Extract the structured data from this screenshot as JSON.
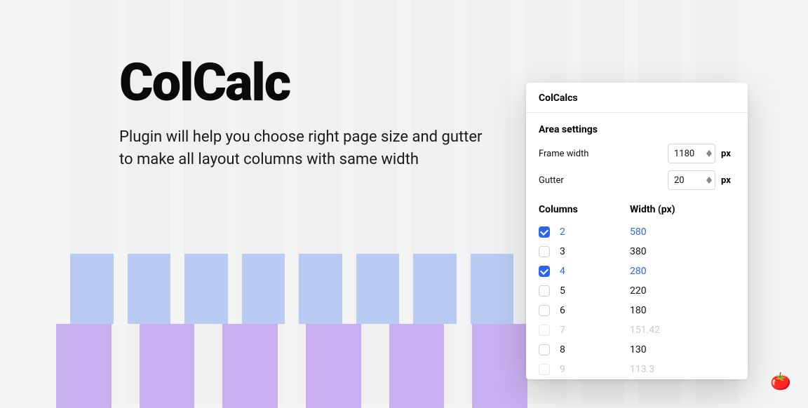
{
  "hero": {
    "title": "ColCalc",
    "subtitle": "Plugin will help you choose right page size and gutter to make all layout columns with same width"
  },
  "panel": {
    "title": "ColCalcs",
    "area_settings": {
      "heading": "Area settings",
      "frame_width_label": "Frame width",
      "frame_width_value": "1180",
      "gutter_label": "Gutter",
      "gutter_value": "20",
      "unit": "px"
    },
    "table": {
      "columns_header": "Columns",
      "width_header": "Width (px)",
      "rows": [
        {
          "cols": "2",
          "width": "580",
          "checked": true,
          "disabled": false
        },
        {
          "cols": "3",
          "width": "380",
          "checked": false,
          "disabled": false
        },
        {
          "cols": "4",
          "width": "280",
          "checked": true,
          "disabled": false
        },
        {
          "cols": "5",
          "width": "220",
          "checked": false,
          "disabled": false
        },
        {
          "cols": "6",
          "width": "180",
          "checked": false,
          "disabled": false
        },
        {
          "cols": "7",
          "width": "151.42",
          "checked": false,
          "disabled": true
        },
        {
          "cols": "8",
          "width": "130",
          "checked": false,
          "disabled": false
        },
        {
          "cols": "9",
          "width": "113.3",
          "checked": false,
          "disabled": true
        }
      ]
    }
  },
  "tomato": "🍅"
}
